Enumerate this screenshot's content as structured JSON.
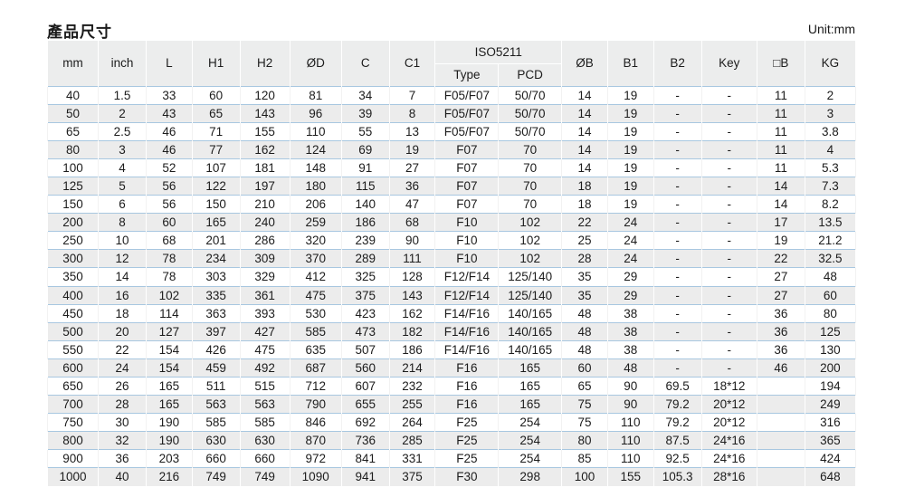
{
  "page": {
    "title": "產品尺寸",
    "unit_label": "Unit:mm"
  },
  "table": {
    "group_headers": [
      {
        "label": "ISO5211",
        "span": 2
      }
    ],
    "columns": [
      {
        "key": "mm",
        "label": "mm"
      },
      {
        "key": "inch",
        "label": "inch"
      },
      {
        "key": "L",
        "label": "L"
      },
      {
        "key": "H1",
        "label": "H1"
      },
      {
        "key": "H2",
        "label": "H2"
      },
      {
        "key": "OD",
        "label": "ØD"
      },
      {
        "key": "C",
        "label": "C"
      },
      {
        "key": "C1",
        "label": "C1"
      },
      {
        "key": "Type",
        "label": "Type"
      },
      {
        "key": "PCD",
        "label": "PCD"
      },
      {
        "key": "OB",
        "label": "ØB"
      },
      {
        "key": "B1",
        "label": "B1"
      },
      {
        "key": "B2",
        "label": "B2"
      },
      {
        "key": "Key",
        "label": "Key"
      },
      {
        "key": "SQB",
        "label": "□B"
      },
      {
        "key": "KG",
        "label": "KG"
      }
    ],
    "rows": [
      [
        "40",
        "1.5",
        "33",
        "60",
        "120",
        "81",
        "34",
        "7",
        "F05/F07",
        "50/70",
        "14",
        "19",
        "-",
        "-",
        "11",
        "2"
      ],
      [
        "50",
        "2",
        "43",
        "65",
        "143",
        "96",
        "39",
        "8",
        "F05/F07",
        "50/70",
        "14",
        "19",
        "-",
        "-",
        "11",
        "3"
      ],
      [
        "65",
        "2.5",
        "46",
        "71",
        "155",
        "110",
        "55",
        "13",
        "F05/F07",
        "50/70",
        "14",
        "19",
        "-",
        "-",
        "11",
        "3.8"
      ],
      [
        "80",
        "3",
        "46",
        "77",
        "162",
        "124",
        "69",
        "19",
        "F07",
        "70",
        "14",
        "19",
        "-",
        "-",
        "11",
        "4"
      ],
      [
        "100",
        "4",
        "52",
        "107",
        "181",
        "148",
        "91",
        "27",
        "F07",
        "70",
        "14",
        "19",
        "-",
        "-",
        "11",
        "5.3"
      ],
      [
        "125",
        "5",
        "56",
        "122",
        "197",
        "180",
        "115",
        "36",
        "F07",
        "70",
        "18",
        "19",
        "-",
        "-",
        "14",
        "7.3"
      ],
      [
        "150",
        "6",
        "56",
        "150",
        "210",
        "206",
        "140",
        "47",
        "F07",
        "70",
        "18",
        "19",
        "-",
        "-",
        "14",
        "8.2"
      ],
      [
        "200",
        "8",
        "60",
        "165",
        "240",
        "259",
        "186",
        "68",
        "F10",
        "102",
        "22",
        "24",
        "-",
        "-",
        "17",
        "13.5"
      ],
      [
        "250",
        "10",
        "68",
        "201",
        "286",
        "320",
        "239",
        "90",
        "F10",
        "102",
        "25",
        "24",
        "-",
        "-",
        "19",
        "21.2"
      ],
      [
        "300",
        "12",
        "78",
        "234",
        "309",
        "370",
        "289",
        "111",
        "F10",
        "102",
        "28",
        "24",
        "-",
        "-",
        "22",
        "32.5"
      ],
      [
        "350",
        "14",
        "78",
        "303",
        "329",
        "412",
        "325",
        "128",
        "F12/F14",
        "125/140",
        "35",
        "29",
        "-",
        "-",
        "27",
        "48"
      ],
      [
        "400",
        "16",
        "102",
        "335",
        "361",
        "475",
        "375",
        "143",
        "F12/F14",
        "125/140",
        "35",
        "29",
        "-",
        "-",
        "27",
        "60"
      ],
      [
        "450",
        "18",
        "114",
        "363",
        "393",
        "530",
        "423",
        "162",
        "F14/F16",
        "140/165",
        "48",
        "38",
        "-",
        "-",
        "36",
        "80"
      ],
      [
        "500",
        "20",
        "127",
        "397",
        "427",
        "585",
        "473",
        "182",
        "F14/F16",
        "140/165",
        "48",
        "38",
        "-",
        "-",
        "36",
        "125"
      ],
      [
        "550",
        "22",
        "154",
        "426",
        "475",
        "635",
        "507",
        "186",
        "F14/F16",
        "140/165",
        "48",
        "38",
        "-",
        "-",
        "36",
        "130"
      ],
      [
        "600",
        "24",
        "154",
        "459",
        "492",
        "687",
        "560",
        "214",
        "F16",
        "165",
        "60",
        "48",
        "-",
        "-",
        "46",
        "200"
      ],
      [
        "650",
        "26",
        "165",
        "511",
        "515",
        "712",
        "607",
        "232",
        "F16",
        "165",
        "65",
        "90",
        "69.5",
        "18*12",
        "",
        "194"
      ],
      [
        "700",
        "28",
        "165",
        "563",
        "563",
        "790",
        "655",
        "255",
        "F16",
        "165",
        "75",
        "90",
        "79.2",
        "20*12",
        "",
        "249"
      ],
      [
        "750",
        "30",
        "190",
        "585",
        "585",
        "846",
        "692",
        "264",
        "F25",
        "254",
        "75",
        "110",
        "79.2",
        "20*12",
        "",
        "316"
      ],
      [
        "800",
        "32",
        "190",
        "630",
        "630",
        "870",
        "736",
        "285",
        "F25",
        "254",
        "80",
        "110",
        "87.5",
        "24*16",
        "",
        "365"
      ],
      [
        "900",
        "36",
        "203",
        "660",
        "660",
        "972",
        "841",
        "331",
        "F25",
        "254",
        "85",
        "110",
        "92.5",
        "24*16",
        "",
        "424"
      ],
      [
        "1000",
        "40",
        "216",
        "749",
        "749",
        "1090",
        "941",
        "375",
        "F30",
        "298",
        "100",
        "155",
        "105.3",
        "28*16",
        "",
        "648"
      ]
    ]
  },
  "colors": {
    "header_bg": "#eceded",
    "row_alt_bg": "#ececec",
    "row_bg": "#ffffff",
    "separator": "#a8c7e0",
    "text": "#1c1c1c"
  }
}
